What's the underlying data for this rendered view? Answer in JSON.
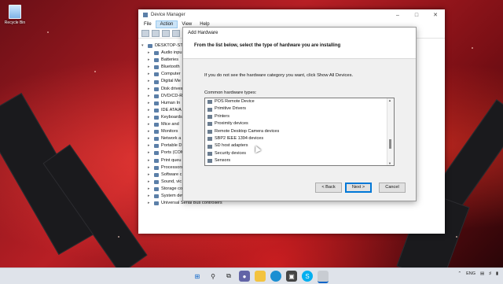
{
  "desktop": {
    "recycle_bin": "Recycle Bin"
  },
  "device_manager": {
    "title": "Device Manager",
    "menu": [
      "File",
      "Action",
      "View",
      "Help"
    ],
    "tree": [
      {
        "label": "DESKTOP-STB",
        "expanded": true,
        "root": true
      },
      {
        "label": "Audio inpu"
      },
      {
        "label": "Batteries"
      },
      {
        "label": "Bluetooth"
      },
      {
        "label": "Computer"
      },
      {
        "label": "Digital Me"
      },
      {
        "label": "Disk drives"
      },
      {
        "label": "DVD/CD-R"
      },
      {
        "label": "Human In"
      },
      {
        "label": "IDE ATA/A"
      },
      {
        "label": "Keyboards"
      },
      {
        "label": "Mice and"
      },
      {
        "label": "Monitors"
      },
      {
        "label": "Network a"
      },
      {
        "label": "Portable D"
      },
      {
        "label": "Ports (COM"
      },
      {
        "label": "Print queu"
      },
      {
        "label": "Processors"
      },
      {
        "label": "Software c"
      },
      {
        "label": "Sound, vic"
      },
      {
        "label": "Storage controllers"
      },
      {
        "label": "System devices"
      },
      {
        "label": "Universal Serial Bus controllers"
      }
    ]
  },
  "add_hardware": {
    "title": "Add Hardware",
    "heading": "From the list below, select the type of hardware you are installing",
    "info": "If you do not see the hardware category you want, click Show All Devices.",
    "list_label": "Common hardware types:",
    "items": [
      "POS Remote Device",
      "Primitive Drivers",
      "Printers",
      "Proximity devices",
      "Remote Desktop Camera devices",
      "SBP2 IEEE 1394 devices",
      "SD host adapters",
      "Security devices",
      "Sensors"
    ],
    "buttons": {
      "back": "< Back",
      "next": "Next >",
      "cancel": "Cancel"
    }
  },
  "taskbar": {
    "icons": [
      "windows-start-icon",
      "search-icon",
      "task-view-icon",
      "chat-icon",
      "file-explorer-icon",
      "edge-icon",
      "store-icon",
      "skype-icon",
      "device-manager-icon"
    ],
    "language": "ENG"
  }
}
